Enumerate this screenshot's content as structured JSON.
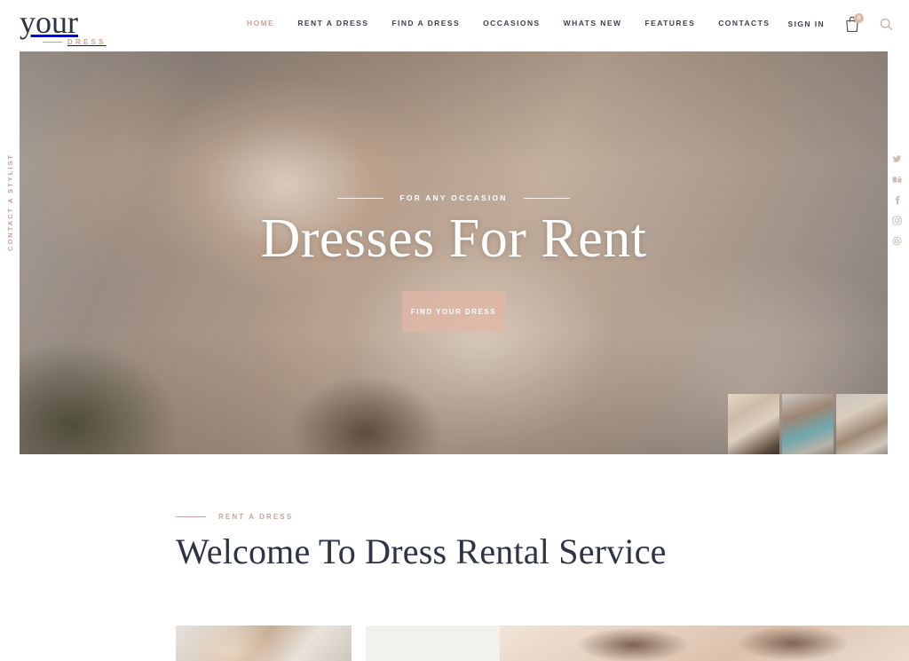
{
  "brand": {
    "name": "your",
    "tagline": "DRESS"
  },
  "header": {
    "nav_items": [
      {
        "label": "HOME",
        "active": true
      },
      {
        "label": "RENT A DRESS",
        "active": false
      },
      {
        "label": "FIND A DRESS",
        "active": false
      },
      {
        "label": "OCCASIONS",
        "active": false
      },
      {
        "label": "WHATS NEW",
        "active": false
      },
      {
        "label": "FEATURES",
        "active": false
      },
      {
        "label": "CONTACTS",
        "active": false
      }
    ],
    "sign_in_label": "SIGN IN",
    "cart_badge_count": "0",
    "cart_icon": "shopping-bag-icon",
    "search_icon": "search-icon"
  },
  "hero": {
    "eyebrow": "FOR ANY OCCASION",
    "title": "Dresses For Rent",
    "cta_label": "FIND YOUR DRESS",
    "thumbnails": [
      {
        "name": "slide-thumb-1"
      },
      {
        "name": "slide-thumb-2"
      },
      {
        "name": "slide-thumb-3"
      }
    ]
  },
  "rails": {
    "left_label": "CONTACT A STYLIST",
    "social": [
      {
        "name": "twitter-icon"
      },
      {
        "name": "behance-icon"
      },
      {
        "name": "facebook-icon"
      },
      {
        "name": "instagram-icon"
      },
      {
        "name": "google-plus-icon"
      }
    ]
  },
  "welcome": {
    "label": "RENT A DRESS",
    "title": "Welcome To Dress Rental Service"
  },
  "colors": {
    "accent": "#cda394",
    "accent_soft": "#e2b6a5",
    "dark": "#2e3443",
    "beige_block": "#f3f1ec",
    "page_bg": "#ffffff"
  }
}
